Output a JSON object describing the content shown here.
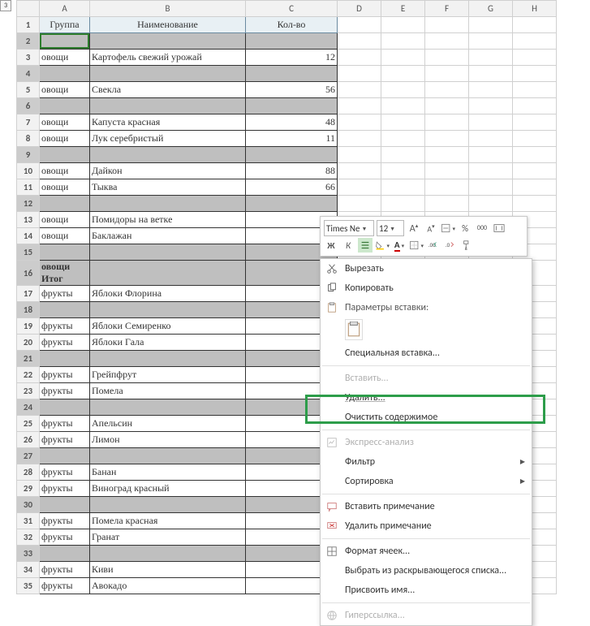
{
  "row_selector_label": "3",
  "columns": [
    "A",
    "B",
    "C",
    "D",
    "E",
    "F",
    "G",
    "H"
  ],
  "col_widths": {
    "A": 62,
    "B": 192,
    "C": 113
  },
  "header": {
    "A": "Группа",
    "B": "Наименование",
    "C": "Кол-во"
  },
  "rows": [
    {
      "n": 1,
      "hdr": true
    },
    {
      "n": 2,
      "sel": true,
      "active": true,
      "a": "",
      "b": "",
      "c": ""
    },
    {
      "n": 3,
      "a": "овощи",
      "b": "Картофель свежий урожай",
      "c": "12"
    },
    {
      "n": 4,
      "sel": true
    },
    {
      "n": 5,
      "a": "овощи",
      "b": "Свекла",
      "c": "56"
    },
    {
      "n": 6,
      "sel": true
    },
    {
      "n": 7,
      "a": "овощи",
      "b": "Капуста красная",
      "c": "48"
    },
    {
      "n": 8,
      "a": "овощи",
      "b": "Лук серебристый",
      "c": "11"
    },
    {
      "n": 9,
      "sel": true
    },
    {
      "n": 10,
      "a": "овощи",
      "b": "Дайкон",
      "c": "88"
    },
    {
      "n": 11,
      "a": "овощи",
      "b": "Тыква",
      "c": "66"
    },
    {
      "n": 12,
      "sel": true
    },
    {
      "n": 13,
      "a": "овощи",
      "b": "Помидоры на ветке",
      "c": ""
    },
    {
      "n": 14,
      "a": "овощи",
      "b": "Баклажан",
      "c": ""
    },
    {
      "n": 15,
      "sel": true
    },
    {
      "n": 16,
      "sel": true,
      "bold": true,
      "a": "овощи Итог",
      "merge": true
    },
    {
      "n": 17,
      "a": "фрукты",
      "b": "Яблоки Флорина",
      "c": ""
    },
    {
      "n": 18,
      "sel": true
    },
    {
      "n": 19,
      "a": "фрукты",
      "b": "Яблоки Семиренко",
      "c": ""
    },
    {
      "n": 20,
      "a": "фрукты",
      "b": "Яблоки Гала",
      "c": ""
    },
    {
      "n": 21,
      "sel": true
    },
    {
      "n": 22,
      "a": "фрукты",
      "b": "Грейпфрут",
      "c": ""
    },
    {
      "n": 23,
      "a": "фрукты",
      "b": "Помела",
      "c": ""
    },
    {
      "n": 24,
      "sel": true
    },
    {
      "n": 25,
      "a": "фрукты",
      "b": "Апельсин",
      "c": ""
    },
    {
      "n": 26,
      "a": "фрукты",
      "b": "Лимон",
      "c": ""
    },
    {
      "n": 27,
      "sel": true
    },
    {
      "n": 28,
      "a": "фрукты",
      "b": "Банан",
      "c": ""
    },
    {
      "n": 29,
      "a": "фрукты",
      "b": "Виноград  красный",
      "c": ""
    },
    {
      "n": 30,
      "sel": true
    },
    {
      "n": 31,
      "a": "фрукты",
      "b": "Помела красная",
      "c": ""
    },
    {
      "n": 32,
      "a": "фрукты",
      "b": "Гранат",
      "c": ""
    },
    {
      "n": 33,
      "sel": true
    },
    {
      "n": 34,
      "a": "фрукты",
      "b": "Киви",
      "c": ""
    },
    {
      "n": 35,
      "a": "фрукты",
      "b": "Авокадо",
      "c": ""
    }
  ],
  "mini_toolbar": {
    "font_name": "Times Ne",
    "font_size": "12",
    "increase_font": "A",
    "decrease_font": "A",
    "percent": "%",
    "thousands": "000",
    "bold": "Ж",
    "italic": "К"
  },
  "context_menu": {
    "cut": "Вырезать",
    "copy": "Копировать",
    "paste_options": "Параметры вставки:",
    "paste_special": "Специальная вставка...",
    "insert": "Вставить...",
    "delete": "Удалить...",
    "clear": "Очистить содержимое",
    "quick_analysis": "Экспресс-анализ",
    "filter": "Фильтр",
    "sort": "Сортировка",
    "insert_comment": "Вставить примечание",
    "delete_comment": "Удалить примечание",
    "format_cells": "Формат ячеек...",
    "pick_list": "Выбрать из раскрывающегося списка...",
    "define_name": "Присвоить имя...",
    "hyperlink": "Гиперссылка..."
  }
}
